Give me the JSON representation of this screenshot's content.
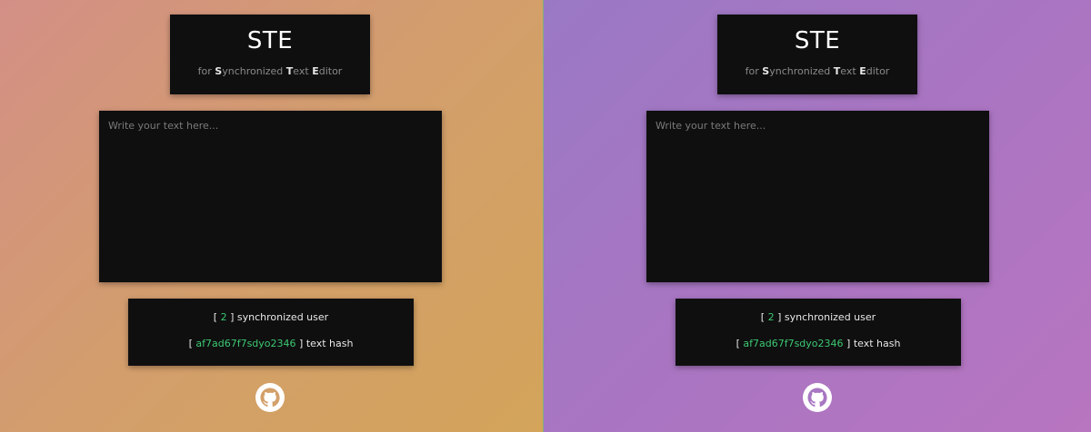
{
  "app": {
    "title": "STE",
    "subtitle_parts": [
      "for ",
      "S",
      "ynchronized ",
      "T",
      "ext ",
      "E",
      "ditor"
    ]
  },
  "editor": {
    "placeholder": "Write your text here..."
  },
  "status": {
    "users_open": "[",
    "users_count": "2",
    "users_close": "]",
    "users_label": "synchronized user",
    "hash_open": "[",
    "hash_value": "af7ad67f7sdyo2346",
    "hash_close": "]",
    "hash_label": "text hash"
  },
  "icons": {
    "github": "github-icon"
  },
  "colors": {
    "card_bg": "#0f0f10",
    "accent_green": "#3cc870",
    "left_gradient": [
      "#d38f86",
      "#d3a45a"
    ],
    "right_gradient": [
      "#9a79c4",
      "#b875c0"
    ]
  }
}
